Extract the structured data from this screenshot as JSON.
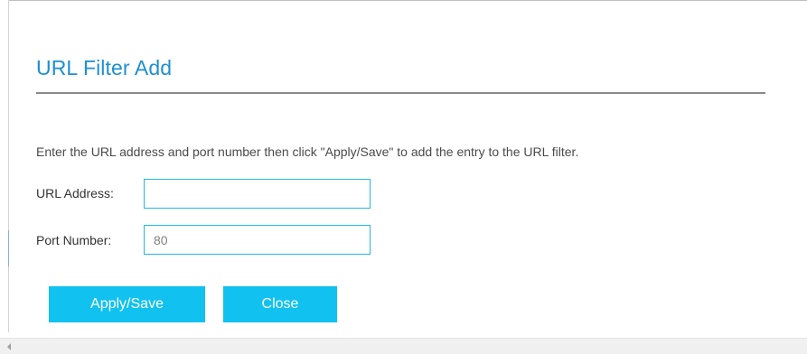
{
  "page": {
    "title": "URL Filter Add",
    "instructions": "Enter the URL address and port number then click \"Apply/Save\" to add the entry to the URL filter."
  },
  "form": {
    "url_address": {
      "label": "URL Address:",
      "value": ""
    },
    "port_number": {
      "label": "Port Number:",
      "value": "80"
    }
  },
  "buttons": {
    "apply_save": "Apply/Save",
    "close": "Close"
  },
  "icons": {
    "scroll_left": "chevron-left-icon"
  },
  "colors": {
    "title": "#1f8fd1",
    "button_bg": "#11c1f0",
    "button_text": "#ffffff",
    "input_border": "#27b6e6",
    "rule": "#8a8a8a"
  }
}
